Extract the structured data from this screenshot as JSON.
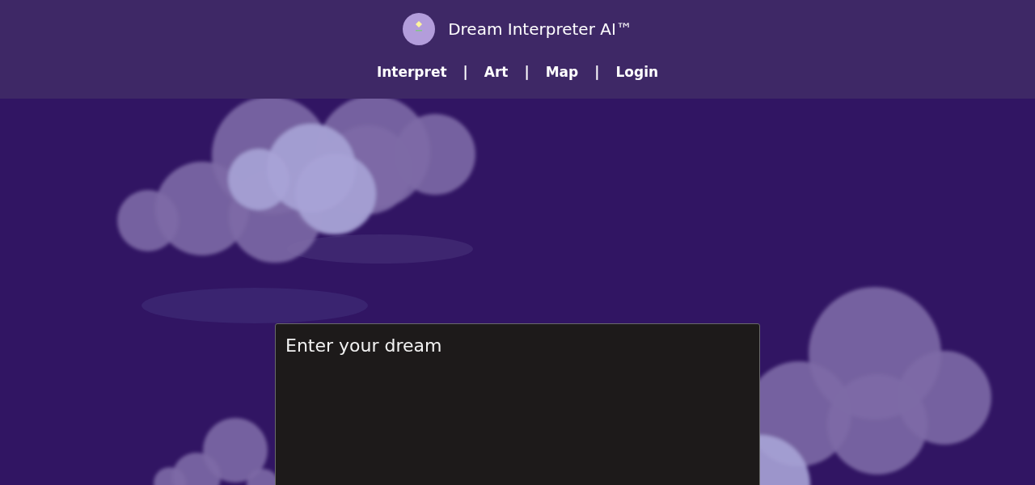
{
  "header": {
    "title": "Dream Interpreter AI™"
  },
  "nav": {
    "links": [
      "Interpret",
      "Art",
      "Map",
      "Login"
    ],
    "separator": "|"
  },
  "dream_input": {
    "placeholder": "Enter your dream"
  }
}
